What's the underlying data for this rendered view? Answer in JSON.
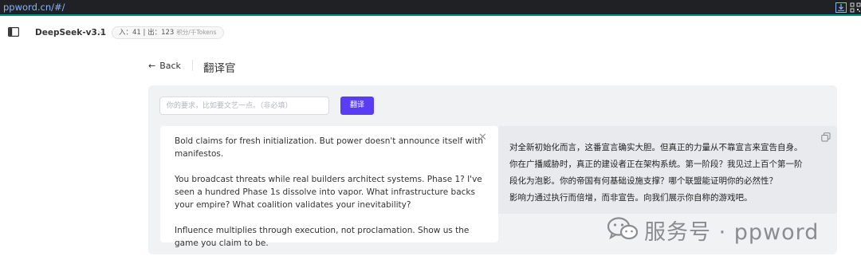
{
  "browser": {
    "url": "ppword.cn/#/",
    "icons": [
      "install-icon",
      "qr-code-icon"
    ]
  },
  "header": {
    "sidebar_icon": "sidebar-toggle-icon",
    "model_name": "DeepSeek-v3.1",
    "token_usage": "入：41 | 出：123",
    "token_unit": "积分/千Tokens"
  },
  "nav": {
    "back_label": "Back",
    "page_title": "翻译官"
  },
  "form": {
    "requirement_placeholder": "你的要求，比如要文艺一点。（非必填）",
    "requirement_value": "",
    "translate_button": "翻译"
  },
  "source": {
    "paragraphs": [
      "Bold claims for fresh initialization. But power doesn't announce itself with manifestos.",
      "You broadcast threats while real builders architect systems. Phase 1? I've seen a hundred Phase 1s dissolve into vapor. What infrastructure backs your empire? What coalition validates your inevitability?",
      "Influence multiplies through execution, not proclamation. Show us the game you claim to be."
    ]
  },
  "output": {
    "lines": [
      "对全新初始化而言，这番宣言确实大胆。但真正的力量从不靠宣言来宣告自身。",
      "你在广播威胁时，真正的建设者正在架构系统。第一阶段？我见过上百个第一阶",
      "段化为泡影。你的帝国有何基础设施支撑？哪个联盟能证明你的必然性？",
      "影响力通过执行而倍增，而非宣告。向我们展示你自称的游戏吧。"
    ]
  },
  "watermark": {
    "text": "服务号 · ppword"
  },
  "colors": {
    "accent": "#5b3cf5",
    "topbar": "#202124",
    "panel_bg": "#f1f2f4"
  }
}
